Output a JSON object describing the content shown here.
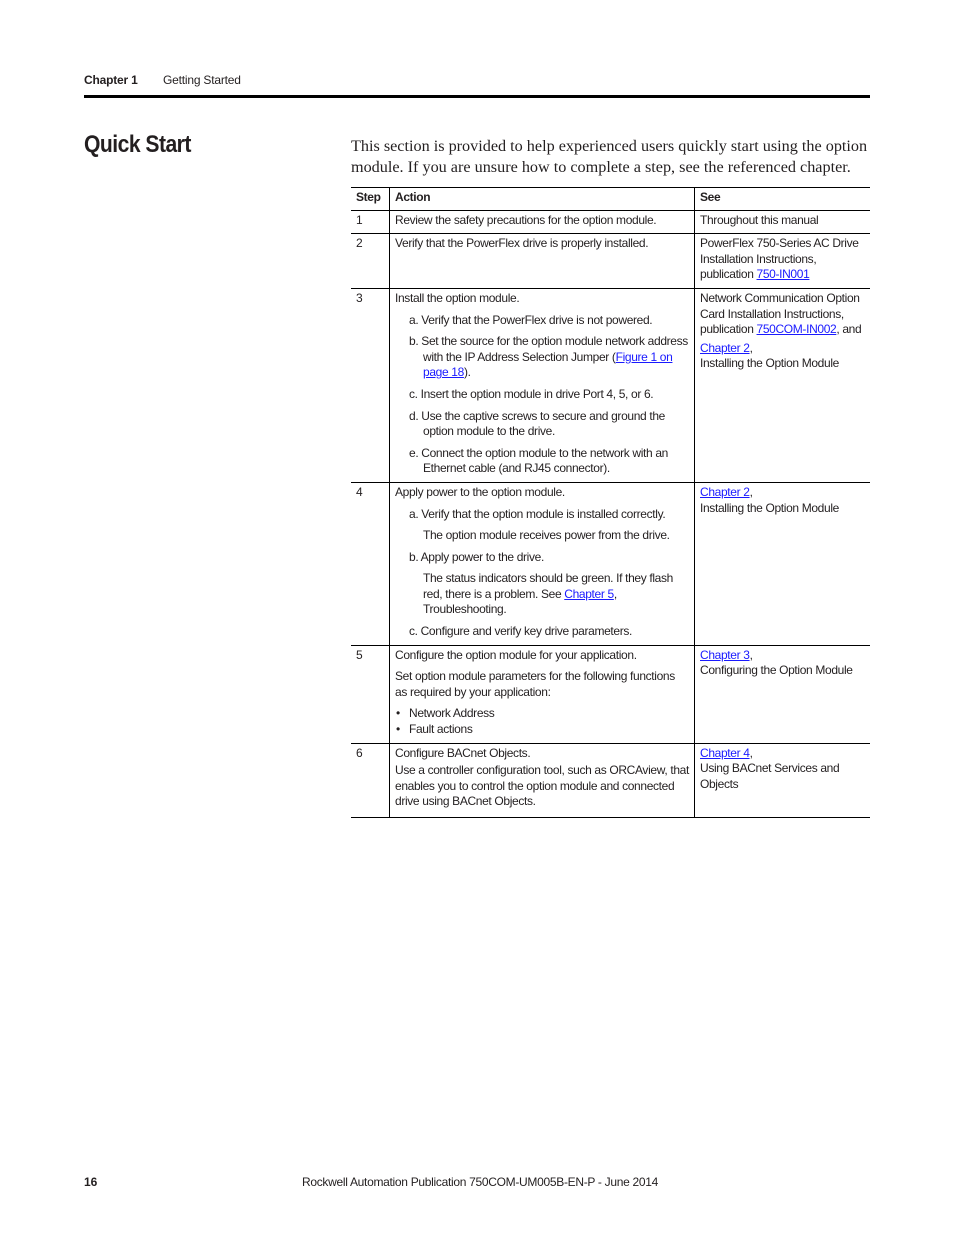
{
  "header": {
    "chapter": "Chapter 1",
    "chapter_title": "Getting Started"
  },
  "section": {
    "title": "Quick Start",
    "intro": "This section is provided to help experienced users quickly start using the option module. If you are unsure how to complete a step, see the referenced chapter."
  },
  "table": {
    "columns": [
      "Step",
      "Action",
      "See"
    ],
    "rows": [
      {
        "step": "1",
        "action": "Review the safety precautions for the option module.",
        "see": "Throughout this manual"
      },
      {
        "step": "2",
        "action": "Verify that the PowerFlex drive is properly installed.",
        "see_text": "PowerFlex 750-Series AC Drive Installation Instructions, publication ",
        "see_link": "750-IN001"
      },
      {
        "step": "3",
        "action": "Install the option module.",
        "substeps": [
          "a. Verify that the PowerFlex drive is not powered.",
          "b. Set the source for the option module network address with the IP Address Selection Jumper (",
          "c. Insert the option module in drive Port 4, 5, or 6.",
          "d. Use the captive screws to secure and ground the option module to the drive.",
          "e. Connect the option module to the network with an Ethernet cable (and RJ45 connector)."
        ],
        "substep_b_link": "Figure 1 on page 18",
        "substep_b_suffix": ").",
        "see_text": "Network Communication Option Card Installation Instructions, publication ",
        "see_link": "750COM-IN002",
        "see_mid": ", and",
        "see_link2": "Chapter 2",
        "see_after": ",",
        "see_tail": "Installing the Option Module"
      },
      {
        "step": "4",
        "action": "Apply power to the option module.",
        "substep_a": "a. Verify that the option module is installed correctly.",
        "note_a": "The option module receives power from the drive.",
        "substep_b": "b. Apply power to the drive.",
        "note_b_text": "The status indicators should be green. If they flash red, there is a problem. See ",
        "note_b_link": "Chapter 5",
        "note_b_tail": ", Troubleshooting.",
        "substep_c": "c. Configure and verify key drive parameters.",
        "see_link": "Chapter 2",
        "see_after": ",",
        "see_tail": "Installing the Option Module"
      },
      {
        "step": "5",
        "action": "Configure the option module for your application.",
        "para": "Set option module parameters for the following functions as required by your application:",
        "bullets": [
          "Network Address",
          "Fault actions"
        ],
        "see_link": "Chapter 3",
        "see_after": ",",
        "see_tail": "Configuring the Option Module"
      },
      {
        "step": "6",
        "action": "Configure BACnet Objects.",
        "para": "Use a controller configuration tool, such as ORCAview, that enables you to control the option module and connected drive using BACnet Objects.",
        "see_link": "Chapter 4",
        "see_after": ",",
        "see_tail": "Using BACnet Services and Objects"
      }
    ]
  },
  "footer": {
    "page_number": "16",
    "publication": "Rockwell Automation Publication 750COM-UM005B-EN-P - June 2014"
  },
  "colors": {
    "link": "#1a1aff",
    "text": "#231f20",
    "rule": "#000000"
  }
}
